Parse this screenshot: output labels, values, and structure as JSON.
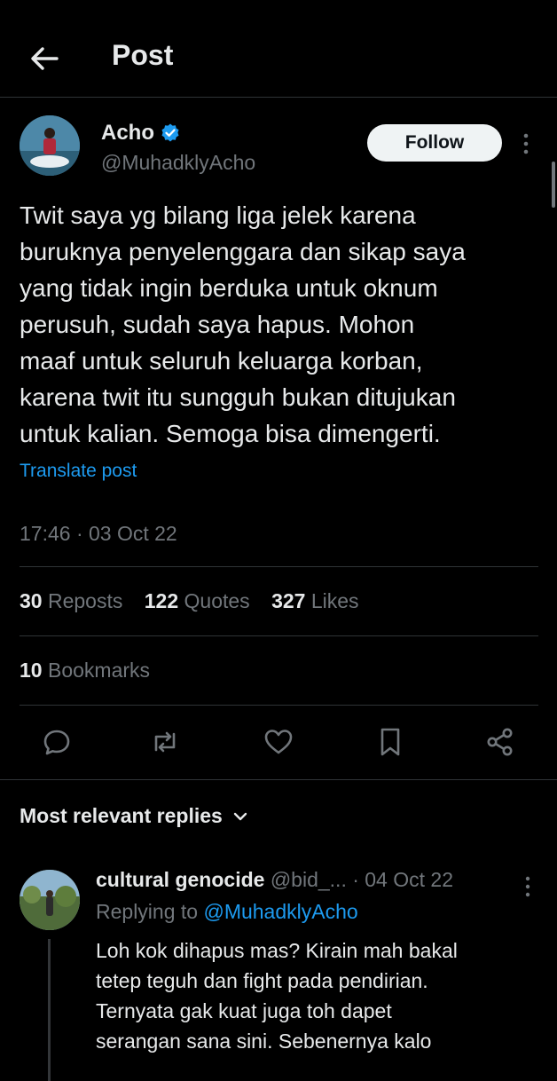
{
  "header": {
    "title": "Post"
  },
  "author": {
    "name": "Acho",
    "handle": "@MuhadklyAcho",
    "follow_label": "Follow"
  },
  "tweet": {
    "lines": [
      "Twit saya yg bilang liga jelek karena",
      "buruknya penyelenggara dan sikap saya",
      "yang tidak ingin berduka untuk oknum",
      "perusuh, sudah saya hapus. Mohon",
      "maaf untuk seluruh keluarga korban,",
      "karena twit itu sungguh bukan ditujukan",
      "untuk kalian. Semoga bisa dimengerti."
    ],
    "translate_label": "Translate post",
    "timestamp": "17:46 · 03 Oct 22"
  },
  "stats": {
    "reposts_count": "30",
    "reposts_label": "Reposts",
    "quotes_count": "122",
    "quotes_label": "Quotes",
    "likes_count": "327",
    "likes_label": "Likes",
    "bookmarks_count": "10",
    "bookmarks_label": "Bookmarks"
  },
  "actions": [
    "reply-icon",
    "repost-icon",
    "like-icon",
    "bookmark-icon",
    "share-icon"
  ],
  "replies": {
    "title": "Most relevant replies",
    "items": [
      {
        "name": "cultural genocide",
        "meta": "@bid_... · 04 Oct 22",
        "replying_prefix": "Replying to",
        "replying_handle": "@MuhadklyAcho",
        "lines": [
          "Loh kok dihapus mas? Kirain mah bakal",
          "tetep teguh dan fight pada pendirian.",
          "Ternyata gak kuat juga toh dapet",
          "serangan sana sini. Sebenernya kalo"
        ]
      }
    ]
  },
  "colors": {
    "background": "#000000",
    "accent": "#1d9bf0",
    "text": "#e7e9ea",
    "muted": "#71767b",
    "border": "#2f3336"
  }
}
